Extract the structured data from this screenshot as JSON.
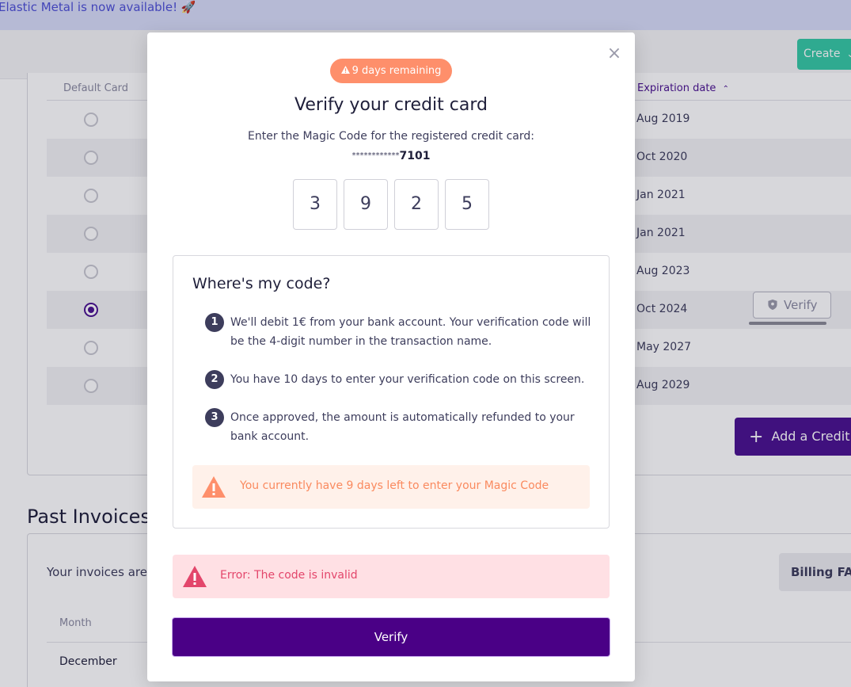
{
  "banner": {
    "text": "Elastic Metal is now available! 🚀"
  },
  "header": {
    "create_label": "Create"
  },
  "cards_table": {
    "col_default": "Default Card",
    "col_expiration": "Expiration date",
    "rows": [
      {
        "expiration": "Aug 2019",
        "default": false
      },
      {
        "expiration": "Oct 2020",
        "default": false
      },
      {
        "expiration": "Jan 2021",
        "default": false
      },
      {
        "expiration": "Jan 2021",
        "default": false
      },
      {
        "expiration": "Aug 2023",
        "default": false
      },
      {
        "expiration": "Oct 2024",
        "default": true
      },
      {
        "expiration": "May 2027",
        "default": false
      },
      {
        "expiration": "Aug 2029",
        "default": false
      }
    ],
    "verify_label": "Verify",
    "add_card_label": "Add a Credit Card"
  },
  "invoices": {
    "title": "Past Invoices",
    "info_text": "Your invoices are listed below.",
    "faq_label": "Billing FAQ",
    "col_month": "Month",
    "first_month": "December"
  },
  "modal": {
    "badge": "9 days remaining",
    "title": "Verify your credit card",
    "instruction": "Enter the Magic Code for the registered credit card:",
    "card_mask": "************",
    "card_last4": "7101",
    "digits": [
      "3",
      "9",
      "2",
      "5"
    ],
    "help": {
      "title": "Where's my code?",
      "steps": [
        {
          "num": "1",
          "text": "We'll debit 1€ from your bank account. Your verification code will be the 4-digit number in the transaction name."
        },
        {
          "num": "2",
          "text": "You have 10 days to enter your verification code on this screen."
        },
        {
          "num": "3",
          "text": "Once approved, the amount is automatically refunded to your bank account."
        }
      ],
      "warning": "You currently have 9 days left to enter your Magic Code"
    },
    "error": "Error: The code is invalid",
    "verify_label": "Verify"
  },
  "colors": {
    "primary": "#4a0086",
    "accent": "#36c9a5",
    "warning": "#fe8f6b",
    "error": "#e3466b"
  }
}
